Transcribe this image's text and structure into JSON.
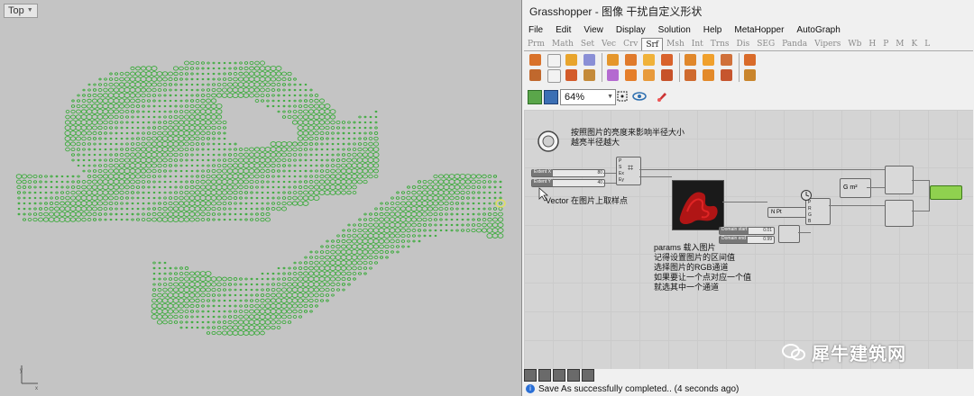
{
  "rhino": {
    "viewport_label": "Top",
    "axis_y": "y",
    "axis_x": "x"
  },
  "grasshopper": {
    "title": "Grasshopper - 图像 干扰自定义形状",
    "menu": [
      "File",
      "Edit",
      "View",
      "Display",
      "Solution",
      "Help",
      "MetaHopper",
      "AutoGraph"
    ],
    "tabs": [
      "Prm",
      "Math",
      "Set",
      "Vec",
      "Crv",
      "Srf",
      "Msh",
      "Int",
      "Trns",
      "Dis",
      "SEG",
      "Panda",
      "Vipers",
      "Wb",
      "H",
      "P",
      "M",
      "K",
      "L"
    ],
    "active_tab": "Srf",
    "zoom": "64%",
    "canvas": {
      "note_top": "按照图片的亮度来影响半径大小\n越亮半径越大",
      "note_vector": "Vector 在图片上取样点",
      "note_params": "params 载入图片\n记得设置图片的区间值\n选择图片的RGB通道\n如果要让一个点对应一个值\n就选其中一个通道",
      "slider_extent_x": {
        "label": "Extent X",
        "value": "80"
      },
      "slider_extent_y": {
        "label": "Extent Y",
        "value": "40"
      },
      "slider_domain_start": {
        "label": "Domain start",
        "value": "0.01"
      },
      "slider_domain_end": {
        "label": "Domain end",
        "value": "0.99"
      },
      "comp_grid_inputs": [
        "P",
        "S",
        "Ex",
        "Ey"
      ],
      "comp_nr_label": "N  Pt",
      "comp_gm_label": "G  m²",
      "comp_rgb": [
        "P",
        "R",
        "G",
        "B"
      ]
    },
    "status": {
      "message": "Save As successfully completed.. (4 seconds ago)"
    }
  },
  "watermark": {
    "text": "犀牛建筑网"
  },
  "colors": {
    "dots": "#2fa82f",
    "viewport_bg": "#c4c4c4",
    "gh_canvas": "#d4d4d4",
    "highlight": "#e0e060"
  }
}
